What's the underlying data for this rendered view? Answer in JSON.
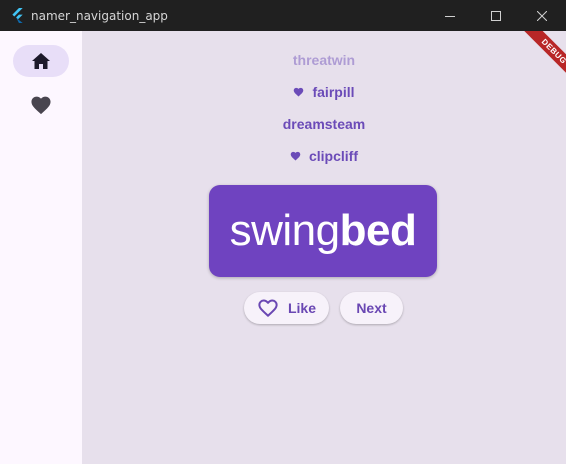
{
  "window": {
    "title": "namer_navigation_app",
    "icon": "flutter-logo-icon",
    "controls": [
      "minimize-icon",
      "maximize-icon",
      "close-icon"
    ]
  },
  "rail": {
    "items": [
      {
        "icon": "home-icon",
        "selected": true
      },
      {
        "icon": "favorite-icon",
        "selected": false
      }
    ]
  },
  "history": [
    {
      "word": "threatwin",
      "favorite": false,
      "faded": true
    },
    {
      "word": "fairpill",
      "favorite": true,
      "faded": false
    },
    {
      "word": "dreamsteam",
      "favorite": false,
      "faded": false
    },
    {
      "word": "clipcliff",
      "favorite": true,
      "faded": false
    }
  ],
  "current_pair": {
    "first": "swing",
    "second": "bed"
  },
  "buttons": {
    "like_label": "Like",
    "next_label": "Next"
  },
  "debug_banner": "DEBUG",
  "colors": {
    "primary": "#6f43c0",
    "background": "#e7e0ec",
    "rail_background": "#fdf7ff",
    "rail_selected": "#e8def8",
    "banner": "#b82727"
  }
}
